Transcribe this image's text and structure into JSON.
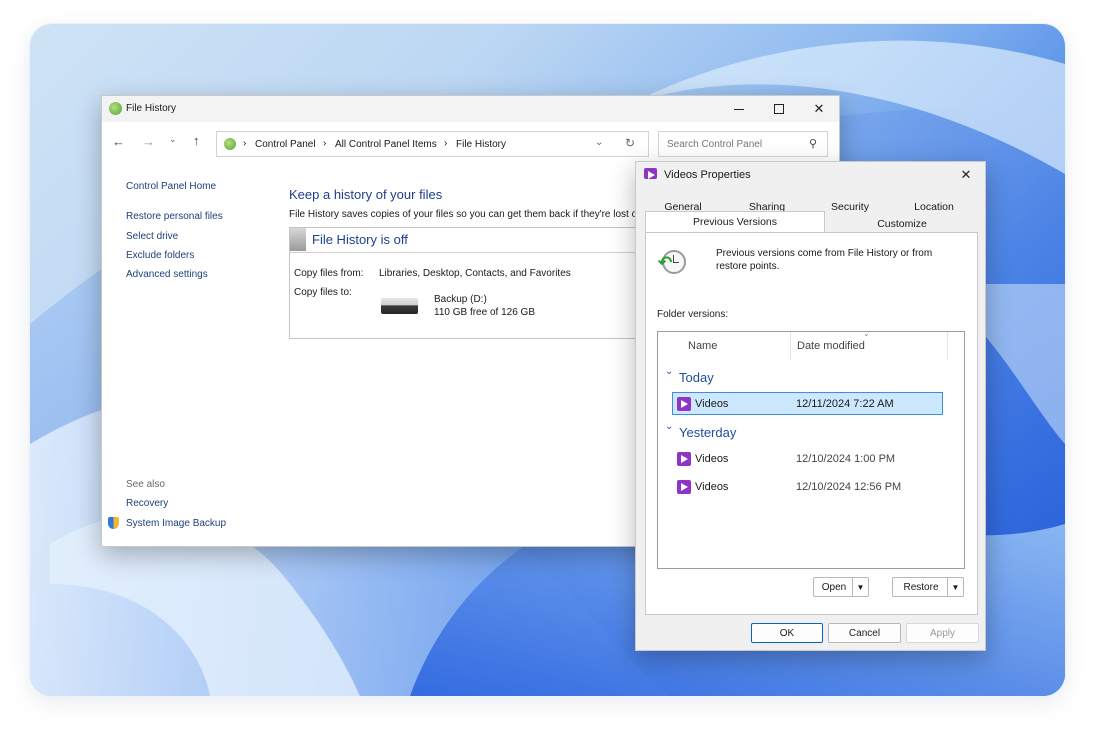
{
  "file_history": {
    "title": "File History",
    "breadcrumb": [
      "Control Panel",
      "All Control Panel Items",
      "File History"
    ],
    "search_placeholder": "Search Control Panel",
    "sidebar": {
      "home": "Control Panel Home",
      "items": [
        "Restore personal files",
        "Select drive",
        "Exclude folders",
        "Advanced settings"
      ],
      "see_also_label": "See also",
      "see_also": [
        "Recovery",
        "System Image Backup"
      ]
    },
    "heading": "Keep a history of your files",
    "description": "File History saves copies of your files so you can get them back if they're lost o",
    "status_title": "File History is off",
    "copy_from_label": "Copy files from:",
    "copy_from_value": "Libraries, Desktop, Contacts, and Favorites",
    "copy_to_label": "Copy files to:",
    "drive_name": "Backup (D:)",
    "drive_space": "110 GB free of 126 GB"
  },
  "properties": {
    "title": "Videos Properties",
    "tabs_row1": [
      "General",
      "Sharing",
      "Security",
      "Location"
    ],
    "tabs_row2": [
      "Previous Versions",
      "Customize"
    ],
    "active_tab": "Previous Versions",
    "info": "Previous versions come from File History or from restore points.",
    "folder_versions_label": "Folder versions:",
    "columns": [
      "Name",
      "Date modified"
    ],
    "groups": [
      {
        "label": "Today",
        "rows": [
          {
            "name": "Videos",
            "date": "12/11/2024 7:22 AM",
            "selected": true
          }
        ]
      },
      {
        "label": "Yesterday",
        "rows": [
          {
            "name": "Videos",
            "date": "12/10/2024 1:00 PM",
            "selected": false
          },
          {
            "name": "Videos",
            "date": "12/10/2024 12:56 PM",
            "selected": false
          }
        ]
      }
    ],
    "open_label": "Open",
    "restore_label": "Restore",
    "ok_label": "OK",
    "cancel_label": "Cancel",
    "apply_label": "Apply"
  },
  "colors": {
    "accent": "#0067c0",
    "link": "#1f3f7a",
    "heading": "#1e3f8f",
    "selection": "#cce8ff",
    "video_icon": "#8e34c6"
  }
}
